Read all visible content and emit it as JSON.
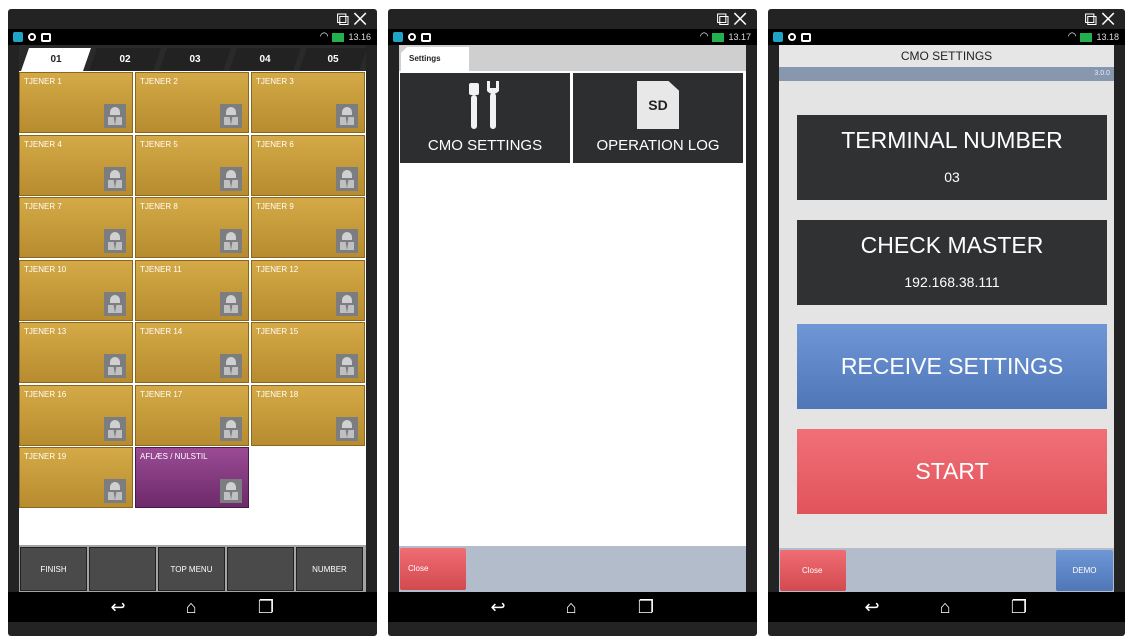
{
  "phone1": {
    "time": "13.16",
    "tabs": [
      "01",
      "02",
      "03",
      "04",
      "05"
    ],
    "cells": [
      "TJENER 1",
      "TJENER 2",
      "TJENER 3",
      "TJENER 4",
      "TJENER 5",
      "TJENER 6",
      "TJENER 7",
      "TJENER 8",
      "TJENER 9",
      "TJENER 10",
      "TJENER 11",
      "TJENER 12",
      "TJENER 13",
      "TJENER 14",
      "TJENER 15",
      "TJENER 16",
      "TJENER 17",
      "TJENER 18",
      "TJENER 19",
      "AFLÆS / NULSTIL"
    ],
    "bottom_buttons": [
      "FINISH",
      "",
      "TOP MENU",
      "",
      "NUMBER"
    ]
  },
  "phone2": {
    "time": "13.17",
    "tab": "Settings",
    "cmo_settings": "CMO SETTINGS",
    "operation_log": "OPERATION LOG",
    "sd_label": "SD",
    "close": "Close"
  },
  "phone3": {
    "time": "13.18",
    "title": "CMO SETTINGS",
    "version": "3.0.0",
    "terminal_number_label": "TERMINAL NUMBER",
    "terminal_number_value": "03",
    "check_master_label": "CHECK MASTER",
    "check_master_value": "192.168.38.111",
    "receive_settings": "RECEIVE SETTINGS",
    "start": "START",
    "close": "Close",
    "demo": "DEMO"
  },
  "window_icons": {
    "popout": "⧉",
    "close": "✕"
  },
  "nav_icons": {
    "back": "↩",
    "home": "⌂",
    "recents": "❐"
  },
  "colors": {
    "gold_tile": "#c99d3c",
    "purple_tile": "#833e7f",
    "blue_button": "#5c84c6",
    "red_button": "#e9636a",
    "dark_panel": "#303132"
  }
}
